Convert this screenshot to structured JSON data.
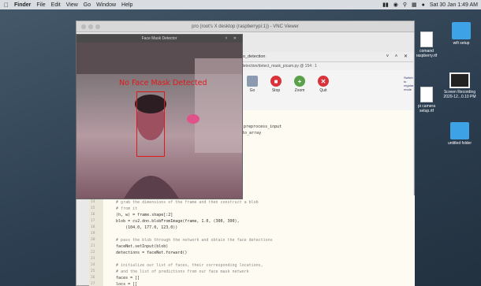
{
  "menubar": {
    "apple": "",
    "app": "Finder",
    "items": [
      "File",
      "Edit",
      "View",
      "Go",
      "Window",
      "Help"
    ],
    "clock": "Sat 30 Jan 1:49 AM"
  },
  "vnc_window": {
    "title": "pro (root's X desktop (raspberrypi:1)) - VNC Viewer"
  },
  "thonny": {
    "title": "o_detection",
    "path": "detection/detect_mask_picam.py @ 154 : 1",
    "toolbar": [
      "Go",
      "Stop",
      "Zoom",
      "Quit"
    ],
    "side_link": "Switch to regular mode"
  },
  "code_top": [
    "t preprocess_input",
    "to_array"
  ],
  "code_lines": [
    {
      "n": "14",
      "text": "    # grab the dimensions of the frame and then construct a blob",
      "comment": true
    },
    {
      "n": "15",
      "text": "    # from it",
      "comment": true
    },
    {
      "n": "16",
      "text": "    (h, w) = frame.shape[:2]",
      "comment": false
    },
    {
      "n": "17",
      "text": "    blob = cv2.dnn.blobFromImage(frame, 1.0, (300, 300),",
      "comment": false
    },
    {
      "n": "18",
      "text": "        (104.0, 177.0, 123.0))",
      "comment": false
    },
    {
      "n": "19",
      "text": "",
      "comment": false
    },
    {
      "n": "20",
      "text": "    # pass the blob through the network and obtain the face detections",
      "comment": true
    },
    {
      "n": "21",
      "text": "    faceNet.setInput(blob)",
      "comment": false
    },
    {
      "n": "22",
      "text": "    detections = faceNet.forward()",
      "comment": false
    },
    {
      "n": "23",
      "text": "",
      "comment": false
    },
    {
      "n": "24",
      "text": "    # initialize our list of faces, their corresponding locations,",
      "comment": true
    },
    {
      "n": "25",
      "text": "    # and the list of predictions from our face mask network",
      "comment": true
    },
    {
      "n": "26",
      "text": "    faces = []",
      "comment": false
    },
    {
      "n": "27",
      "text": "    locs = []",
      "comment": false
    }
  ],
  "face_mask_window": {
    "title": "Face Mask Detector",
    "label": "No Face Mask Detected"
  },
  "desktop_icons": [
    {
      "name": "wifi setup",
      "kind": "folder"
    },
    {
      "name": "comand\nraspberry.rtf",
      "kind": "doc"
    },
    {
      "name": "pi camera\nsetup.rtf",
      "kind": "doc"
    },
    {
      "name": "Screen Recording\n2020-12...0.10 PM",
      "kind": "shot"
    },
    {
      "name": "untitled folder",
      "kind": "folder"
    }
  ],
  "colors": {
    "desktop": "#2f4456",
    "label_red": "#e01818",
    "folder_blue": "#3ea2e6"
  }
}
